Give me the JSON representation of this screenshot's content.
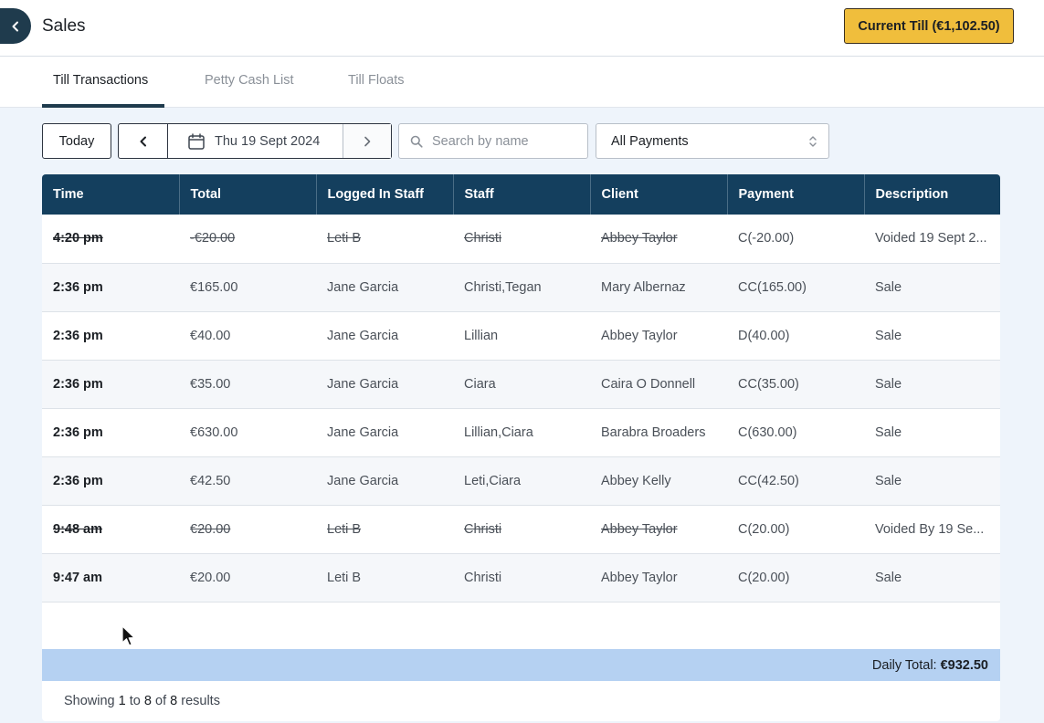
{
  "header": {
    "title": "Sales",
    "till_button": "Current Till (€1,102.50)"
  },
  "tabs": [
    {
      "label": "Till Transactions",
      "active": true
    },
    {
      "label": "Petty Cash List",
      "active": false
    },
    {
      "label": "Till Floats",
      "active": false
    }
  ],
  "filters": {
    "today_label": "Today",
    "date": "Thu 19 Sept 2024",
    "search_placeholder": "Search by name",
    "payment_filter": "All Payments"
  },
  "table": {
    "columns": [
      "Time",
      "Total",
      "Logged In Staff",
      "Staff",
      "Client",
      "Payment",
      "Description"
    ],
    "rows": [
      {
        "time": "4:20 pm",
        "total": "-€20.00",
        "logged_in": "Leti B",
        "staff": "Christi",
        "client": "Abbey Taylor",
        "payment": "C(-20.00)",
        "description": "Voided 19 Sept 2...",
        "voided": true
      },
      {
        "time": "2:36 pm",
        "total": "€165.00",
        "logged_in": "Jane Garcia",
        "staff": "Christi,Tegan",
        "client": "Mary Albernaz",
        "payment": "CC(165.00)",
        "description": "Sale",
        "voided": false
      },
      {
        "time": "2:36 pm",
        "total": "€40.00",
        "logged_in": "Jane Garcia",
        "staff": "Lillian",
        "client": "Abbey Taylor",
        "payment": "D(40.00)",
        "description": "Sale",
        "voided": false
      },
      {
        "time": "2:36 pm",
        "total": "€35.00",
        "logged_in": "Jane Garcia",
        "staff": "Ciara",
        "client": "Caira O Donnell",
        "payment": "CC(35.00)",
        "description": "Sale",
        "voided": false
      },
      {
        "time": "2:36 pm",
        "total": "€630.00",
        "logged_in": "Jane Garcia",
        "staff": "Lillian,Ciara",
        "client": "Barabra Broaders",
        "payment": "C(630.00)",
        "description": "Sale",
        "voided": false
      },
      {
        "time": "2:36 pm",
        "total": "€42.50",
        "logged_in": "Jane Garcia",
        "staff": "Leti,Ciara",
        "client": "Abbey Kelly",
        "payment": "CC(42.50)",
        "description": "Sale",
        "voided": false
      },
      {
        "time": "9:48 am",
        "total": "€20.00",
        "logged_in": "Leti B",
        "staff": "Christi",
        "client": "Abbey Taylor",
        "payment": "C(20.00)",
        "description": "Voided By 19 Se...",
        "voided": true
      },
      {
        "time": "9:47 am",
        "total": "€20.00",
        "logged_in": "Leti B",
        "staff": "Christi",
        "client": "Abbey Taylor",
        "payment": "C(20.00)",
        "description": "Sale",
        "voided": false
      }
    ]
  },
  "summary": {
    "daily_total_label": "Daily Total:",
    "daily_total_value": "€932.50"
  },
  "pagination": {
    "prefix": "Showing",
    "from": "1",
    "to_word": "to",
    "to": "8",
    "of_word": "of",
    "total": "8",
    "suffix": "results"
  },
  "colors": {
    "header_bg": "#143f5e",
    "accent": "#f0be3c",
    "total_bar": "#b5d1f2"
  }
}
